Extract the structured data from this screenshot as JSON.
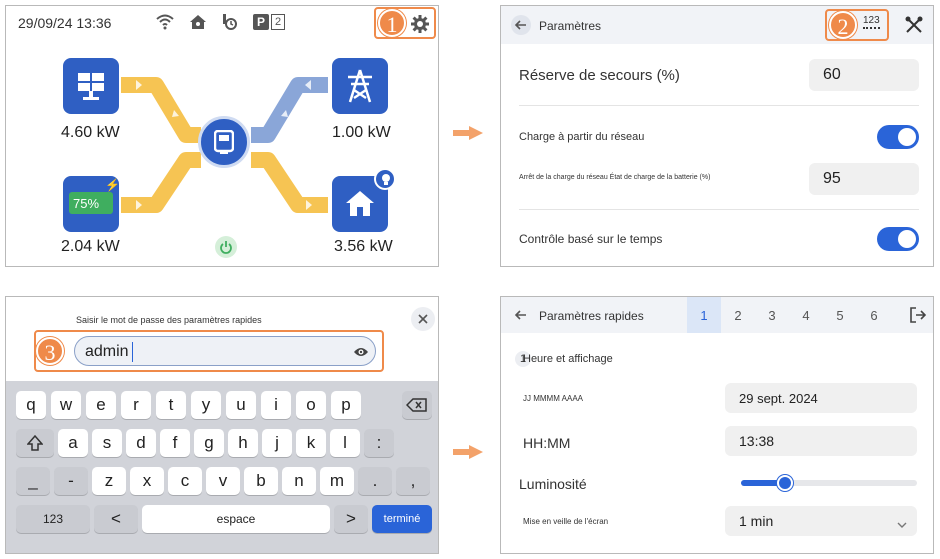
{
  "panel1": {
    "datetime": "29/09/24 13:36",
    "p_badge": "P",
    "p_number": "2",
    "solar_power": "4.60 kW",
    "grid_power": "1.00 kW",
    "battery_power": "2.04 kW",
    "battery_soc": "75%",
    "home_power": "3.56 kW",
    "callout_number": "1"
  },
  "panel2": {
    "title": "Paramètres",
    "numeric_icon_label": "123",
    "callout_number": "2",
    "backup_reserve_label": "Réserve de secours (%)",
    "backup_reserve_value": "60",
    "grid_charge_label": "Charge à partir du réseau",
    "grid_charge_stop_label": "Arrêt de la charge du réseau État de charge de la batterie (%)",
    "grid_charge_stop_value": "95",
    "time_control_label": "Contrôle basé sur le temps"
  },
  "panel3": {
    "prompt": "Saisir le mot de passe des paramètres rapides",
    "password_value": "admin",
    "callout_number": "3",
    "keyboard": {
      "row1": [
        "q",
        "w",
        "e",
        "r",
        "t",
        "y",
        "u",
        "i",
        "o",
        "p"
      ],
      "row2": [
        "a",
        "s",
        "d",
        "f",
        "g",
        "h",
        "j",
        "k",
        "l",
        ":"
      ],
      "row3": [
        "_",
        "-",
        "z",
        "x",
        "c",
        "v",
        "b",
        "n",
        "m",
        ".",
        ","
      ],
      "numbers_key": "123",
      "space_key": "espace",
      "done_key": "terminé"
    }
  },
  "panel4": {
    "title": "Paramètres rapides",
    "pages": [
      "1",
      "2",
      "3",
      "4",
      "5",
      "6"
    ],
    "active_page": "1",
    "section_number": "1",
    "section_title": "Heure et affichage",
    "date_format_label": "JJ MMMM AAAA",
    "date_value": "29 sept. 2024",
    "time_format_label": "HH:MM",
    "time_value": "13:38",
    "brightness_label": "Luminosité",
    "brightness_level": 0.25,
    "sleep_label": "Mise en veille de l'écran",
    "sleep_value": "1 min"
  },
  "colors": {
    "accent_blue": "#2a64d8",
    "callout_orange": "#ef8a4a",
    "flow_yellow": "#f6c453",
    "flow_blue": "#8aa6d8",
    "tile_blue": "#2f5fc3",
    "battery_green": "#3fae5f"
  }
}
